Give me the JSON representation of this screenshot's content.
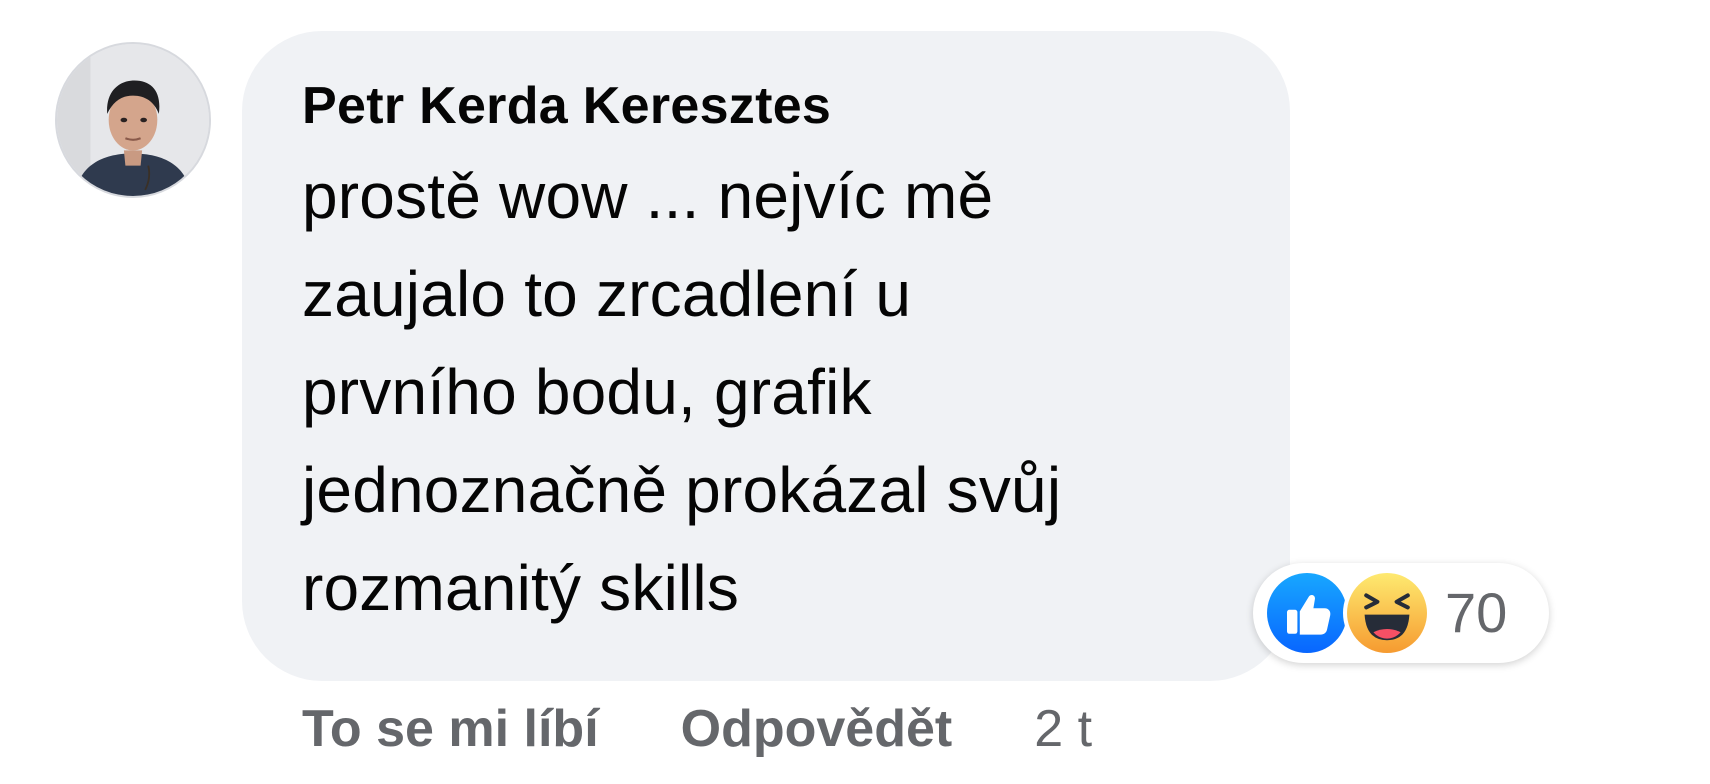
{
  "comment": {
    "author": "Petr Kerda Keresztes",
    "text": "prostě wow ... nejvíc mě\nzaujalo to zrcadlení u\nprvního bodu, grafik\njednoznačně prokázal svůj\nrozmanitý skills",
    "reactions": {
      "icons": [
        "like-icon",
        "haha-icon"
      ],
      "count": "70"
    },
    "actions": {
      "like_label": "To se mi líbí",
      "reply_label": "Odpovědět",
      "timestamp": "2 t"
    }
  },
  "colors": {
    "bubble_bg": "#f0f2f5",
    "text": "#050505",
    "secondary_text": "#65676b",
    "like_blue": "#1877f2",
    "haha_yellow": "#f7b125"
  }
}
